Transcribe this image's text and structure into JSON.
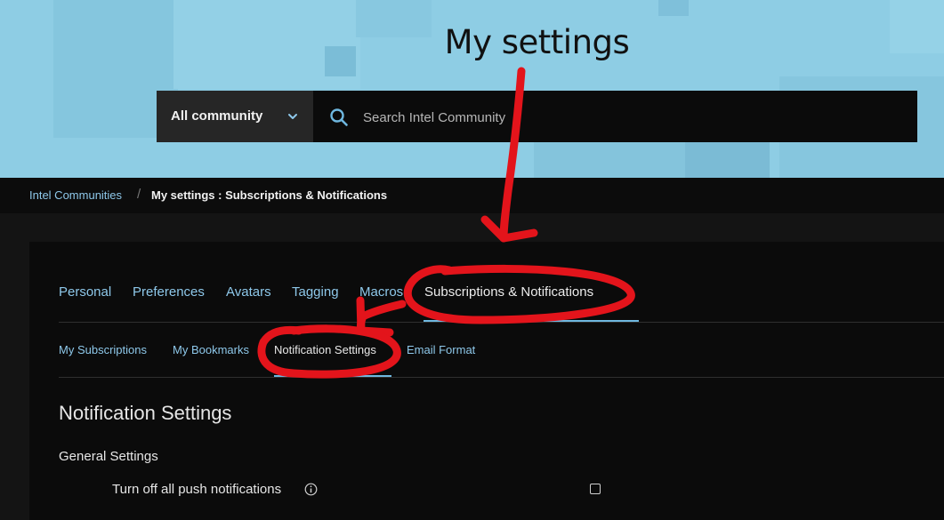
{
  "hero": {
    "title": "My settings"
  },
  "search": {
    "scope_label": "All community",
    "placeholder": "Search Intel Community"
  },
  "breadcrumb": {
    "root": "Intel Communities",
    "separator": "/",
    "current": "My settings : Subscriptions & Notifications"
  },
  "tabs": [
    {
      "label": "Personal"
    },
    {
      "label": "Preferences"
    },
    {
      "label": "Avatars"
    },
    {
      "label": "Tagging"
    },
    {
      "label": "Macros"
    },
    {
      "label": "Subscriptions & Notifications",
      "active": true
    }
  ],
  "subtabs": [
    {
      "label": "My Subscriptions"
    },
    {
      "label": "My Bookmarks"
    },
    {
      "label": "Notification Settings",
      "active": true
    },
    {
      "label": "Email Format"
    }
  ],
  "content": {
    "section_title": "Notification Settings",
    "group_title": "General Settings",
    "options": [
      {
        "label": "Turn off all push notifications",
        "checked": false
      }
    ]
  },
  "colors": {
    "hero_bg": "#8ecde4",
    "page_bg": "#141414",
    "link": "#8ec8ea",
    "accent_underline": "#6fb8e0",
    "annotation_red": "#e3141b"
  },
  "icons": [
    "chevron-down-icon",
    "search-icon",
    "info-icon"
  ]
}
